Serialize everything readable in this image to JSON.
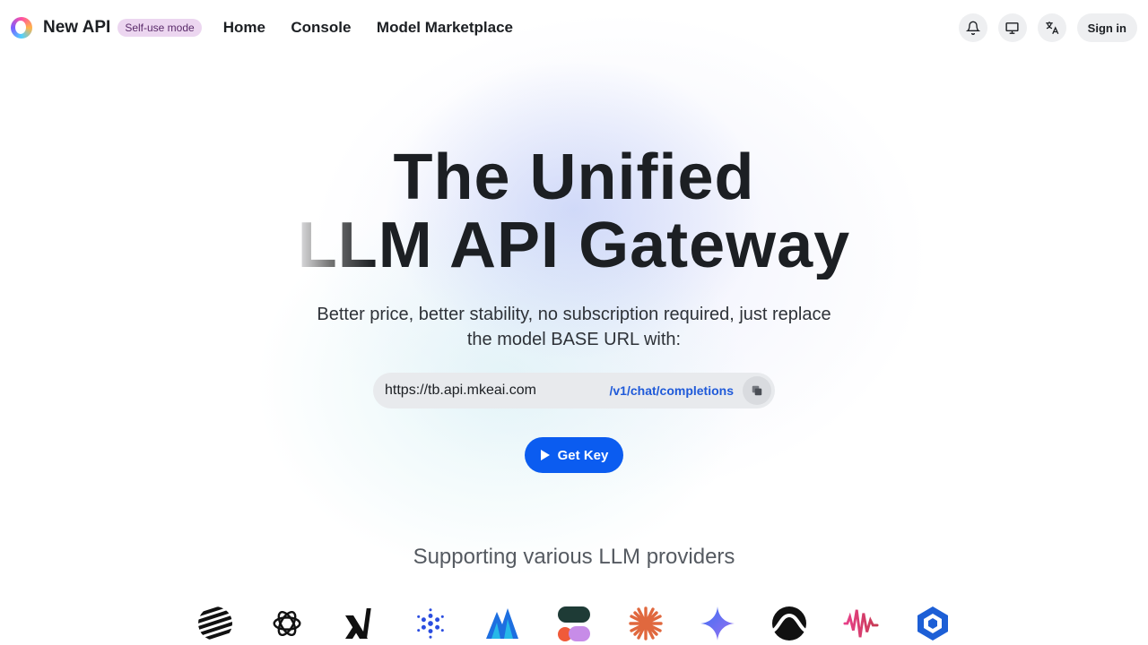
{
  "header": {
    "brand": "New API",
    "badge": "Self-use mode",
    "nav": [
      "Home",
      "Console",
      "Model Marketplace"
    ],
    "sign_in": "Sign in",
    "icons": [
      "bell-icon",
      "monitor-icon",
      "translate-icon"
    ]
  },
  "hero": {
    "title_line1": "The Unified",
    "title_line2": "LLM API Gateway",
    "subtitle": "Better price, better stability, no subscription required, just replace the model BASE URL with:",
    "base_url": "https://tb.api.mkeai.com",
    "endpoint_prefix": "/v1",
    "endpoint_suffix": "/chat/completions",
    "get_key": "Get Key"
  },
  "providers": {
    "title": "Supporting various LLM providers",
    "icons": [
      "striped-globe-icon",
      "openai-icon",
      "xai-icon",
      "dotted-flower-icon",
      "mountain-peaks-icon",
      "capsule-icon",
      "asterisk-burst-icon",
      "gemini-star-icon",
      "wave-s-icon",
      "soundwave-icon",
      "hex-cube-icon"
    ]
  },
  "colors": {
    "accent": "#0b5cf0",
    "badge_bg": "#ecd6f0",
    "endpoint": "#1f5ad9"
  }
}
